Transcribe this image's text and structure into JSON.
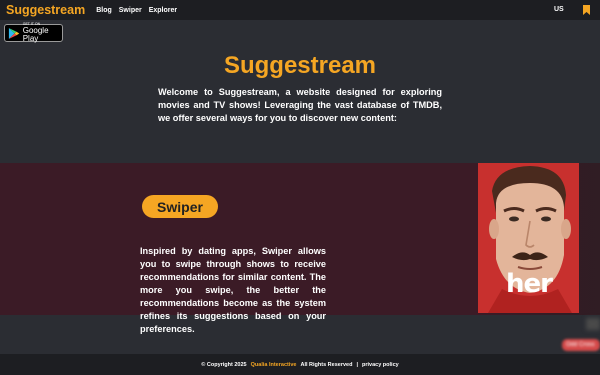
{
  "header": {
    "brand": "Suggestream",
    "nav": [
      "Blog",
      "Swiper",
      "Explorer"
    ],
    "region": "US",
    "bookmark_icon": "bookmark-icon"
  },
  "store_badge": {
    "small_text": "GET IT ON",
    "big_text": "Google Play",
    "icon": "google-play-icon"
  },
  "hero": {
    "title": "Suggestream",
    "intro": "Welcome to Suggestream, a website designed for exploring movies and TV shows! Leveraging the vast database of TMDB, we offer several ways for you to discover new content:"
  },
  "feature": {
    "label": "Swiper",
    "description": "Inspired by dating apps, Swiper allows you to swipe through shows to receive recommendations for similar content. The more you swipe, the better the recommendations become as the system refines its suggestions based on your preferences.",
    "poster_title": "her"
  },
  "side_chip": "Odd Cross",
  "footer": {
    "copyright": "© Copyright 2025",
    "company": "Qualia Interactive",
    "rights": "All Rights Reserved",
    "separator": "|",
    "privacy": "privacy policy"
  },
  "colors": {
    "accent": "#f5a623",
    "background": "#2b2d33",
    "bar": "#1d1e22",
    "band": "#3b1b26"
  }
}
